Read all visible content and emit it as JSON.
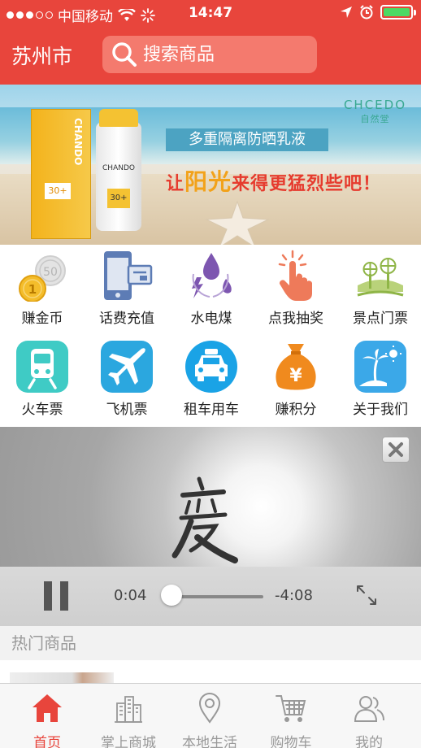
{
  "status_bar": {
    "carrier": "中国移动",
    "time": "14:47",
    "battery_color": "#4cd964"
  },
  "header": {
    "city": "苏州市",
    "search_placeholder": "搜索商品",
    "background_color": "#e8453c"
  },
  "banner": {
    "brand_logo": "CHCEDO",
    "brand_logo_sub": "自然堂",
    "headline": "多重隔离防晒乳液",
    "slogan_prefix": "让",
    "slogan_highlight": "阳光",
    "slogan_suffix": "来得更猛烈些吧！",
    "product_brand": "CHANDO",
    "spf": "30+"
  },
  "grid": [
    {
      "label": "赚金币",
      "icon": "coins-icon"
    },
    {
      "label": "话费充值",
      "icon": "phone-recharge-icon"
    },
    {
      "label": "水电煤",
      "icon": "utilities-icon"
    },
    {
      "label": "点我抽奖",
      "icon": "lottery-tap-icon"
    },
    {
      "label": "景点门票",
      "icon": "scenic-ticket-icon"
    },
    {
      "label": "火车票",
      "icon": "train-icon"
    },
    {
      "label": "飞机票",
      "icon": "airplane-icon"
    },
    {
      "label": "租车用车",
      "icon": "taxi-icon"
    },
    {
      "label": "赚积分",
      "icon": "money-bag-icon"
    },
    {
      "label": "关于我们",
      "icon": "island-icon"
    }
  ],
  "video": {
    "current_time": "0:04",
    "remaining_time": "-4:08",
    "progress": 0.016
  },
  "hot": {
    "title": "热门商品"
  },
  "tabbar": [
    {
      "label": "首页",
      "icon": "home-icon",
      "active": true
    },
    {
      "label": "掌上商城",
      "icon": "mall-icon",
      "active": false
    },
    {
      "label": "本地生活",
      "icon": "location-icon",
      "active": false
    },
    {
      "label": "购物车",
      "icon": "cart-icon",
      "active": false
    },
    {
      "label": "我的",
      "icon": "user-icon",
      "active": false
    }
  ]
}
